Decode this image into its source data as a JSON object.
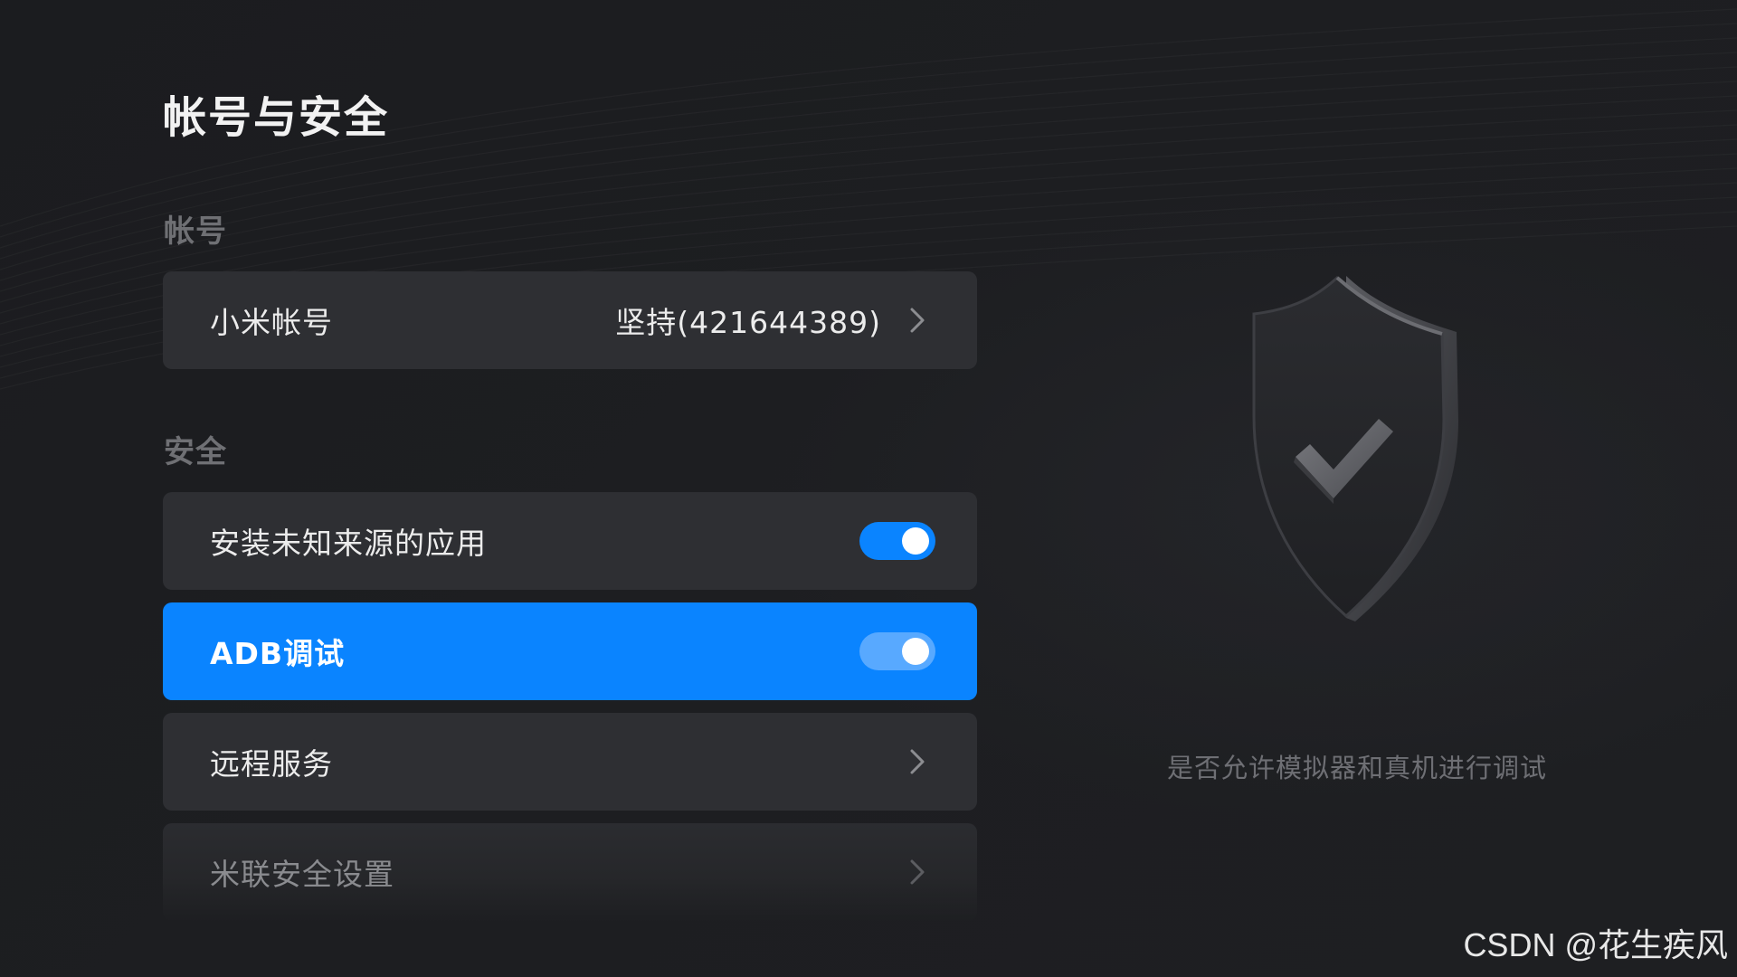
{
  "page": {
    "title": "帐号与安全"
  },
  "sections": {
    "account_label": "帐号",
    "security_label": "安全"
  },
  "rows": {
    "account": {
      "label": "小米帐号",
      "value": "坚持(421644389)",
      "icon": "chevron-right-icon"
    },
    "unknown_sources": {
      "label": "安装未知来源的应用",
      "toggle_on": true
    },
    "adb": {
      "label": "ADB调试",
      "toggle_on": true,
      "focused": true
    },
    "remote": {
      "label": "远程服务",
      "icon": "chevron-right-icon"
    },
    "milian": {
      "label": "米联安全设置",
      "icon": "chevron-right-icon"
    }
  },
  "illustration": {
    "icon": "shield-check-icon",
    "description": "是否允许模拟器和真机进行调试"
  },
  "watermark": "CSDN @花生疾风",
  "colors": {
    "accent": "#0a84ff",
    "row_bg": "#2e2f33",
    "background": "#1d1e21"
  }
}
